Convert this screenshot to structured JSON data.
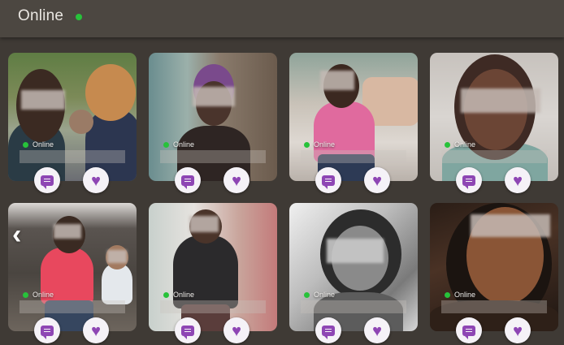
{
  "header": {
    "title": "Online"
  },
  "colors": {
    "online": "#27c23a",
    "accent": "#8e46b4"
  },
  "icons": {
    "message": "chat-icon",
    "favorite": "heart-icon",
    "prev": "chevron-left-icon"
  },
  "profiles": [
    {
      "status": "Online"
    },
    {
      "status": "Online"
    },
    {
      "status": "Online"
    },
    {
      "status": "Online"
    },
    {
      "status": "Online"
    },
    {
      "status": "Online"
    },
    {
      "status": "Online"
    },
    {
      "status": "Online"
    }
  ],
  "nav": {
    "prev_glyph": "‹"
  }
}
